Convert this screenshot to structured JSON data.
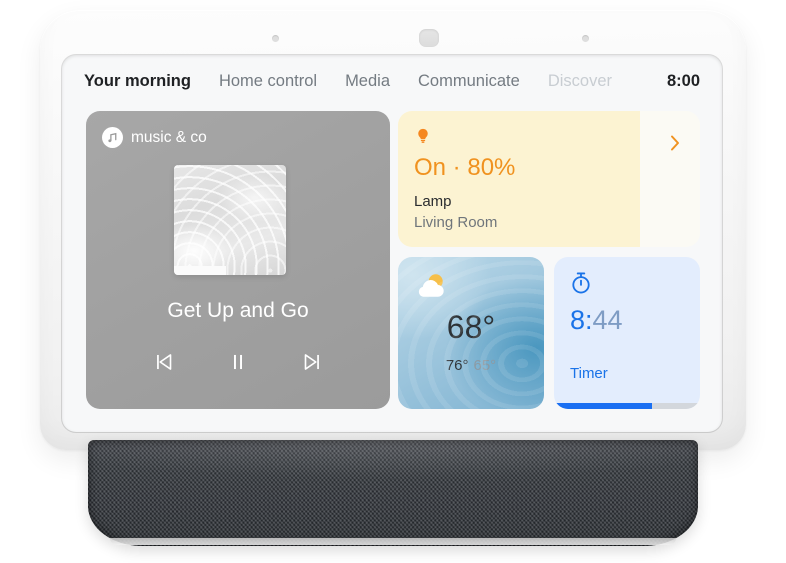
{
  "device": {
    "name": "smart-display-speaker",
    "top_sensor": "ambient-light-sensor",
    "mic_holes": 2
  },
  "nav": {
    "items": [
      {
        "label": "Your morning",
        "state": "active"
      },
      {
        "label": "Home control",
        "state": "normal"
      },
      {
        "label": "Media",
        "state": "normal"
      },
      {
        "label": "Communicate",
        "state": "normal"
      },
      {
        "label": "Discover",
        "state": "faded"
      }
    ],
    "clock": "8:00"
  },
  "music_card": {
    "source": "music & co",
    "source_icon": "music-note-icon",
    "album_art": "abstract-water-ripple-artwork",
    "track_title": "Get Up and Go",
    "controls": [
      {
        "name": "previous-track-button",
        "icon": "skip-previous-icon"
      },
      {
        "name": "pause-button",
        "icon": "pause-icon"
      },
      {
        "name": "next-track-button",
        "icon": "skip-next-icon"
      }
    ]
  },
  "lamp_card": {
    "icon": "lightbulb-icon",
    "state": "On · 80%",
    "brightness_percent": 80,
    "name": "Lamp",
    "room": "Living Room",
    "chevron_icon": "chevron-right-icon",
    "accent_color": "#f0921f",
    "fill_color": "#fcf3d2",
    "track_color": "#fbfaf4"
  },
  "weather_card": {
    "icon": "sun-behind-cloud-icon",
    "current_temp": "68°",
    "high_temp": "76°",
    "low_temp": "65°"
  },
  "timer_card": {
    "icon": "timer-icon",
    "time_elapsed": "8:",
    "time_remaining": "44",
    "label": "Timer",
    "progress_percent": 67,
    "accent_color": "#1a73e8"
  }
}
